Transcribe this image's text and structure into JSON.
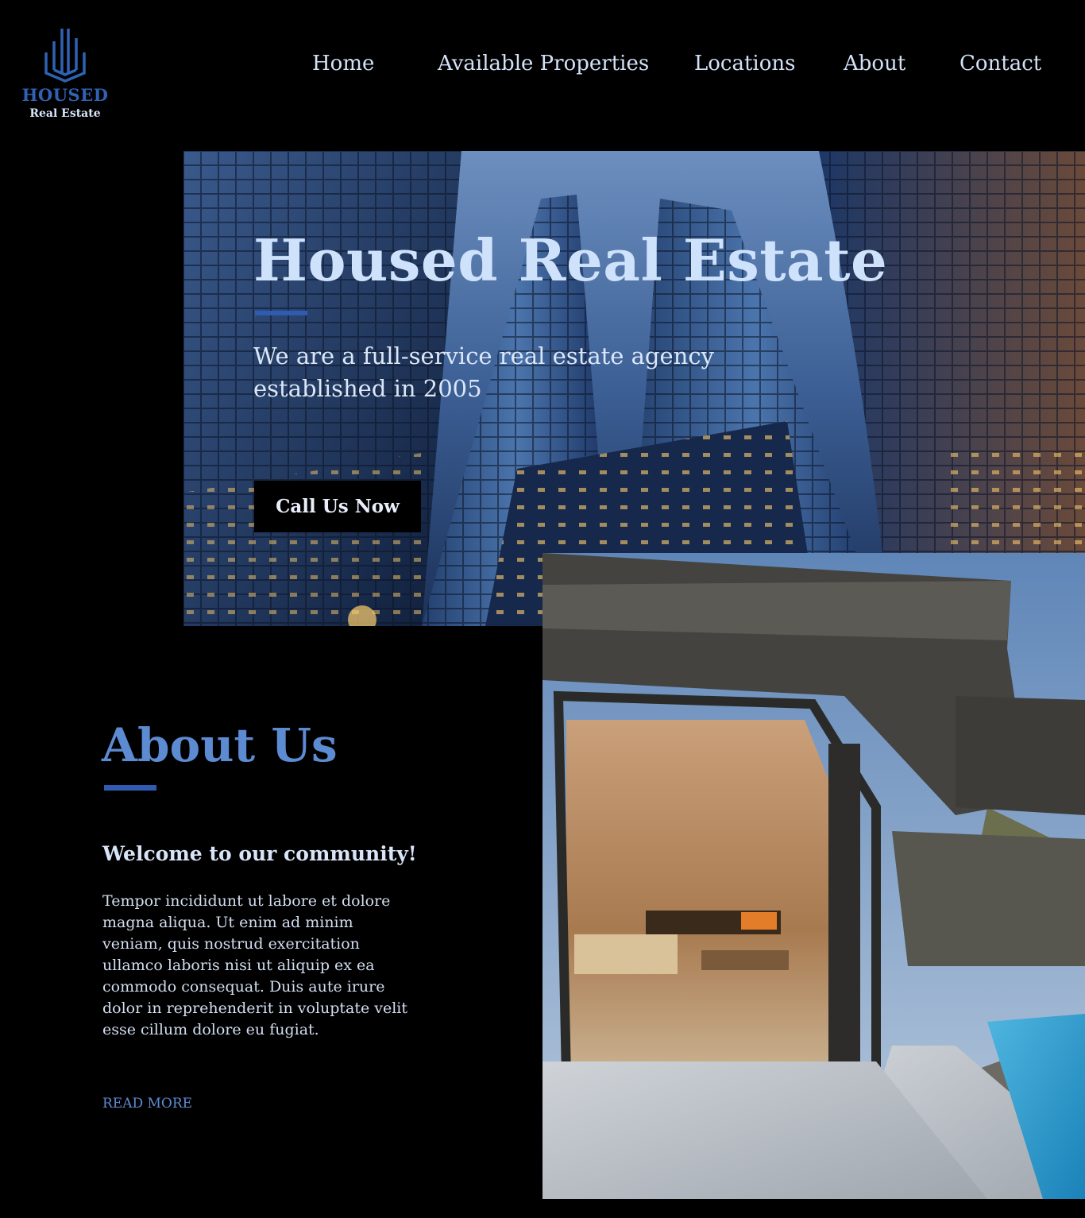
{
  "logo": {
    "wordmark": "HOUSED",
    "tagline": "Real Estate",
    "icon": "building-towers-icon",
    "color": "#2f62b3"
  },
  "nav": {
    "items": [
      {
        "label": "Home"
      },
      {
        "label": "Available Properties"
      },
      {
        "label": "Locations"
      },
      {
        "label": "About"
      },
      {
        "label": "Contact"
      }
    ]
  },
  "hero": {
    "title": "Housed Real Estate",
    "subtitle": "We are a full-service real estate agency established in 2005",
    "cta_label": "Call Us Now",
    "image": "city-skyscrapers-photo"
  },
  "about": {
    "title": "About Us",
    "welcome": "Welcome to our community!",
    "body": "Tempor incididunt ut labore et dolore magna aliqua. Ut enim ad minim veniam, quis nostrud exercitation ullamco laboris nisi ut aliquip ex ea commodo consequat. Duis aute irure dolor in reprehenderit in voluptate velit esse cillum dolore eu fugiat.",
    "read_more": "READ MORE",
    "image": "modern-house-pool-photo"
  },
  "colors": {
    "background": "#000000",
    "accent": "#2f5bb0",
    "heading_blue": "#5c8bd2",
    "text_light": "#d3def1"
  }
}
